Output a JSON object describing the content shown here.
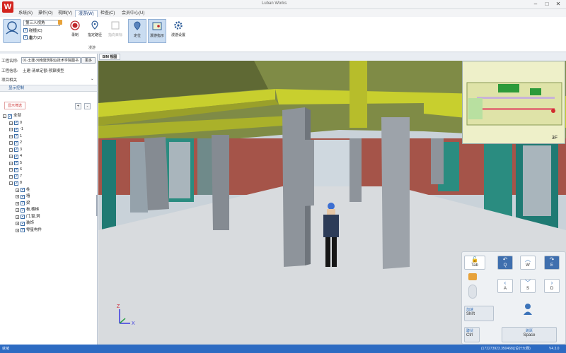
{
  "window": {
    "title": "Luban Works"
  },
  "menu": [
    {
      "label": "系统(S)"
    },
    {
      "label": "操作(O)"
    },
    {
      "label": "视图(V)"
    },
    {
      "label": "漫游(W)",
      "active": true
    },
    {
      "label": "检查(C)"
    },
    {
      "label": "会员中心(U)"
    }
  ],
  "ribbon": {
    "person_label": "人物",
    "view_mode": "第三人视角",
    "collision_label": "碰撞(C)",
    "gravity_label": "重力(Z)",
    "record_label": "录制",
    "set_path_label": "指定路径",
    "locate_target_label": "指向目标",
    "locate_label": "定位",
    "roam_tip_label": "漫游指示",
    "roam_settings_label": "漫游设置",
    "group_label": "漫游"
  },
  "doc_tab": "BIM 视图",
  "left_panel": {
    "project_name_label": "工程名称:",
    "project_name_value": "01-土建-河南建筑职业技术学院图书",
    "more_button": "更多",
    "project_info_label": "工程信息:",
    "project_info_value": "土建-清单定额-预算模型",
    "project_related_label": "项目相关",
    "display_control_label": "显示控制",
    "filter_button": "显示筛选",
    "plus_button": "+",
    "minus_button": "-",
    "tree": [
      {
        "label": "全部",
        "level": 0,
        "toggle": "-"
      },
      {
        "label": "0",
        "level": 1,
        "toggle": "+"
      },
      {
        "label": "-1",
        "level": 1,
        "toggle": "+"
      },
      {
        "label": "1",
        "level": 1,
        "toggle": "+"
      },
      {
        "label": "2",
        "level": 1,
        "toggle": "+"
      },
      {
        "label": "3",
        "level": 1,
        "toggle": "+"
      },
      {
        "label": "4",
        "level": 1,
        "toggle": "+"
      },
      {
        "label": "5",
        "level": 1,
        "toggle": "+"
      },
      {
        "label": "6",
        "level": 1,
        "toggle": "+"
      },
      {
        "label": "7",
        "level": 1,
        "toggle": "+"
      },
      {
        "label": "8",
        "level": 1,
        "toggle": "-"
      },
      {
        "label": "柱",
        "level": 2,
        "toggle": "+"
      },
      {
        "label": "墙",
        "level": 2,
        "toggle": "+"
      },
      {
        "label": "梁",
        "level": 2,
        "toggle": "+"
      },
      {
        "label": "板,楼梯",
        "level": 2,
        "toggle": "+"
      },
      {
        "label": "门,窗,洞",
        "level": 2,
        "toggle": "+"
      },
      {
        "label": "装饰",
        "level": 2,
        "toggle": "+"
      },
      {
        "label": "零星构件",
        "level": 2,
        "toggle": "+"
      }
    ]
  },
  "minimap": {
    "floor": "3F"
  },
  "axes": {
    "x": "X",
    "z": "Z"
  },
  "controls": {
    "tab_key": "Tab",
    "q_key": "Q",
    "w_key": "W",
    "e_key": "E",
    "a_key": "A",
    "s_key": "S",
    "d_key": "D",
    "speed_cn": "加速",
    "speed_key": "Shift",
    "crouch_cn": "蹲伏",
    "crouch_key": "Ctrl",
    "jump_cn": "跳跃",
    "jump_key": "Space"
  },
  "status": {
    "left": "就绪",
    "center": "(172273923.350468)(设计大赛)",
    "right": "V4.3.0"
  },
  "colors": {
    "ceiling": "#6f7a3a",
    "beam": "#b8bf2a",
    "column": "#9aa0a8",
    "brick": "#a2524a",
    "floor": "#d5d8db",
    "accent": "#2d6bc2"
  }
}
